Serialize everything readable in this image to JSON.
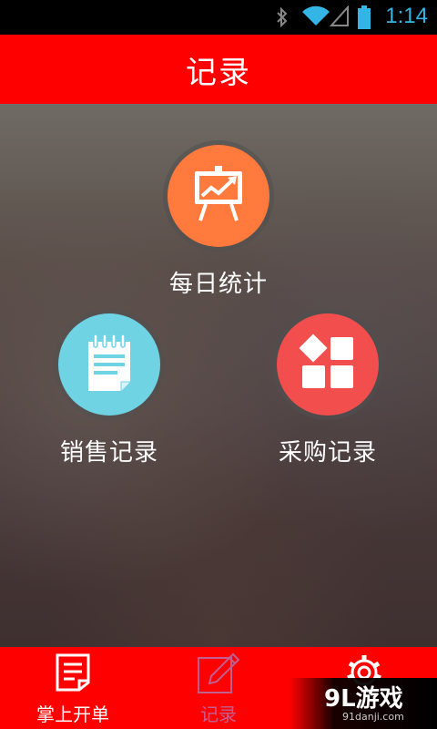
{
  "status_bar": {
    "time": "1:14",
    "icons": [
      "bluetooth-icon",
      "wifi-icon",
      "signal-icon",
      "battery-icon"
    ],
    "accent_color": "#33b5e5"
  },
  "header": {
    "title": "记录",
    "color": "#ff0000"
  },
  "menu": [
    {
      "label": "每日统计",
      "icon": "presentation-chart-icon",
      "color": "#ff7a3c"
    },
    {
      "label": "销售记录",
      "icon": "notepad-icon",
      "color": "#6fd3e3"
    },
    {
      "label": "采购记录",
      "icon": "category-blocks-icon",
      "color": "#f24e4e"
    }
  ],
  "bottom_nav": {
    "tabs": [
      {
        "label": "掌上开单",
        "icon": "document-icon",
        "active": false
      },
      {
        "label": "记录",
        "icon": "edit-icon",
        "active": true
      },
      {
        "label": "",
        "icon": "gear-icon",
        "active": false
      }
    ],
    "active_color": "#c06090"
  },
  "watermark": {
    "brand": "9L游戏",
    "site": "91danji.com"
  }
}
